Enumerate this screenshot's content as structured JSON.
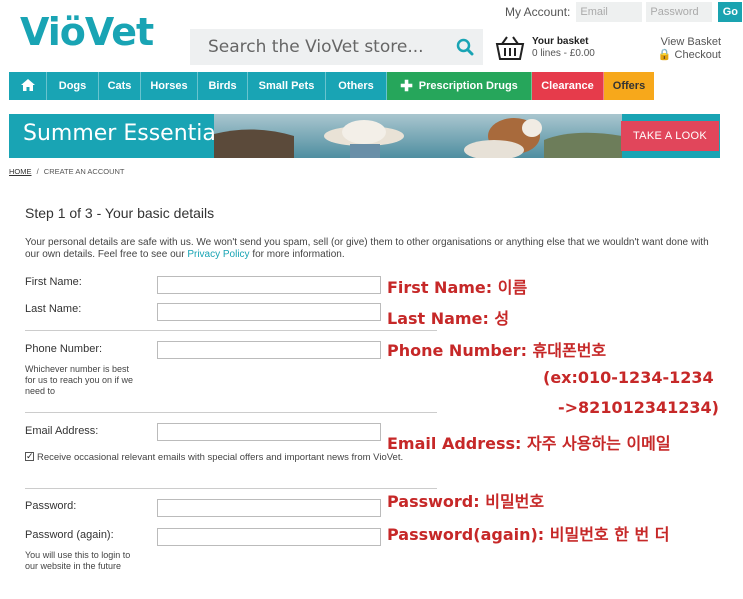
{
  "account": {
    "label": "My Account:",
    "email_placeholder": "Email",
    "password_placeholder": "Password",
    "go_label": "Go"
  },
  "brand": {
    "logo_text": "ViöVet",
    "accent": "#19a4b4"
  },
  "search": {
    "placeholder": "Search the VioVet store..."
  },
  "basket": {
    "title": "Your basket",
    "summary": "0 lines - £0.00",
    "view_label": "View Basket",
    "checkout_label": "Checkout"
  },
  "nav": {
    "items": [
      {
        "label": "",
        "icon": "home-icon"
      },
      {
        "label": "Dogs"
      },
      {
        "label": "Cats"
      },
      {
        "label": "Horses"
      },
      {
        "label": "Birds"
      },
      {
        "label": "Small Pets"
      },
      {
        "label": "Others"
      },
      {
        "label": "Prescription Drugs",
        "icon": "plus-icon"
      },
      {
        "label": "Clearance"
      },
      {
        "label": "Offers"
      }
    ]
  },
  "banner": {
    "title": "Summer Essentials",
    "cta": "TAKE A LOOK"
  },
  "breadcrumb": {
    "home": "HOME",
    "separator": "/",
    "current": "CREATE AN ACCOUNT"
  },
  "form": {
    "step_title": "Step 1 of 3 - Your basic details",
    "intro_before": "Your personal details are safe with us. We won't send you spam, sell (or give) them to other organisations or anything else that we wouldn't want done with our own details. Feel free to see our ",
    "intro_link": "Privacy Policy",
    "intro_after": " for more information.",
    "first_name_label": "First Name:",
    "last_name_label": "Last Name:",
    "phone_label": "Phone Number:",
    "phone_hint": "Whichever number is best for us to reach you on if we need to",
    "email_label": "Email Address:",
    "email_opt_in": "Receive occasional relevant emails with special offers and important news from VioVet.",
    "password_label": "Password:",
    "password_again_label": "Password (again):",
    "password_hint": "You will use this to login to our website in the future"
  },
  "annotations": {
    "first_name": "First Name: 이름",
    "last_name": "Last Name: 성",
    "phone": "Phone Number: 휴대폰번호",
    "phone_example": "(ex:010-1234-1234",
    "phone_example2": "->821012341234)",
    "email": "Email Address: 자주 사용하는 이메일",
    "password": "Password: 비밀번호",
    "password_again": "Password(again): 비밀번호 한 번 더"
  }
}
